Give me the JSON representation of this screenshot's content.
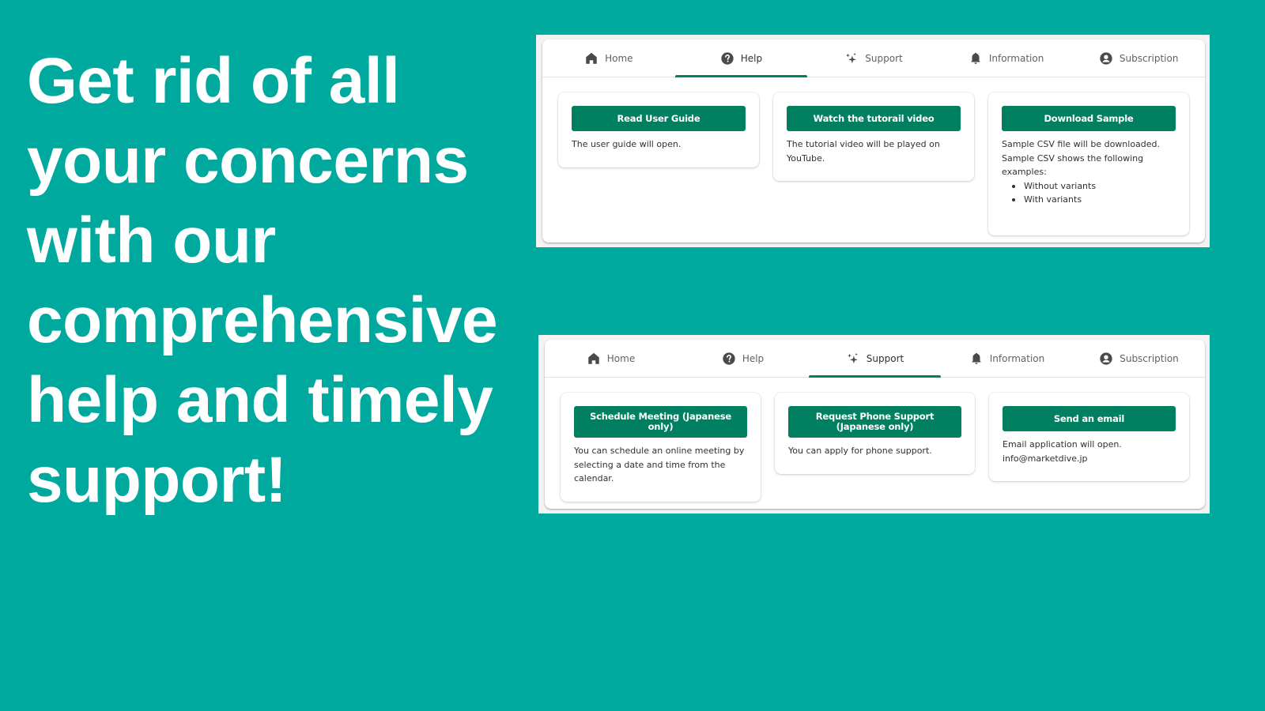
{
  "headline": {
    "lines": [
      "Get rid of all",
      "your concerns",
      "with our",
      "comprehensive",
      "help and timely",
      "support!"
    ]
  },
  "colors": {
    "background": "#00a99d",
    "accent": "#008060",
    "text": "#303030",
    "tab_text": "#616161"
  },
  "help_screen": {
    "active_tab": "Help",
    "tabs": [
      {
        "label": "Home",
        "icon": "home-icon"
      },
      {
        "label": "Help",
        "icon": "question-circle-icon"
      },
      {
        "label": "Support",
        "icon": "sparkles-icon"
      },
      {
        "label": "Information",
        "icon": "bell-icon"
      },
      {
        "label": "Subscription",
        "icon": "user-circle-icon"
      }
    ],
    "cards": [
      {
        "button": "Read User Guide",
        "description": "The user guide will open."
      },
      {
        "button": "Watch the tutorail video",
        "description": "The tutorial video will be played on YouTube."
      },
      {
        "button": "Download Sample",
        "description": "Sample CSV file will be downloaded. Sample CSV shows the following examples:",
        "items": [
          "Without variants",
          "With variants"
        ]
      }
    ]
  },
  "support_screen": {
    "active_tab": "Support",
    "tabs": [
      {
        "label": "Home",
        "icon": "home-icon"
      },
      {
        "label": "Help",
        "icon": "question-circle-icon"
      },
      {
        "label": "Support",
        "icon": "sparkles-icon"
      },
      {
        "label": "Information",
        "icon": "bell-icon"
      },
      {
        "label": "Subscription",
        "icon": "user-circle-icon"
      }
    ],
    "cards": [
      {
        "button": "Schedule Meeting (Japanese only)",
        "description": "You can schedule an online meeting by selecting a date and time from the calendar."
      },
      {
        "button": "Request Phone Support (Japanese only)",
        "description": "You can apply for phone support."
      },
      {
        "button": "Send an email",
        "description": "Email application will open.",
        "email": "info@marketdive.jp"
      }
    ]
  }
}
